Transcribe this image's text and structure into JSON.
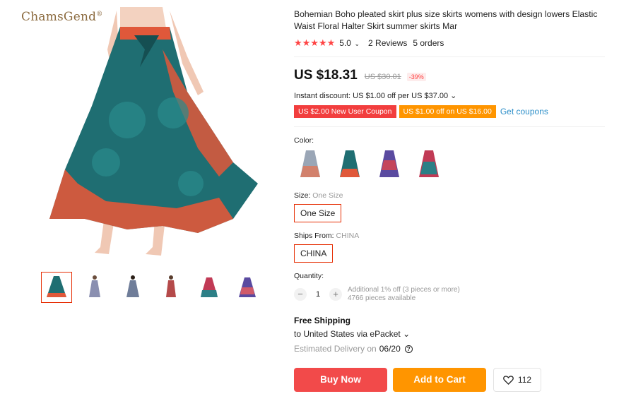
{
  "brand": {
    "name": "ChamsGend",
    "mark": "®"
  },
  "product": {
    "title": "Bohemian Boho pleated skirt plus size skirts womens with design lowers Elastic Waist Floral Halter Skirt summer skirts Mar",
    "rating": "5.0",
    "reviews": "2 Reviews",
    "orders": "5 orders"
  },
  "price": {
    "current": "US $18.31",
    "original": "US $30.01",
    "discount": "-39%",
    "instant_discount": "Instant discount: US $1.00 off per US $37.00"
  },
  "coupons": {
    "new_user": "US $2.00 New User Coupon",
    "store": "US $1.00 off on US $16.00",
    "get_label": "Get coupons"
  },
  "color": {
    "label": "Color:"
  },
  "size": {
    "label": "Size:",
    "value_hint": "One Size",
    "selected": "One Size"
  },
  "ships_from": {
    "label": "Ships From:",
    "value_hint": "CHINA",
    "selected": "CHINA"
  },
  "quantity": {
    "label": "Quantity:",
    "value": "1",
    "minus": "−",
    "plus": "+",
    "note": "Additional 1% off (3 pieces or more)",
    "available": "4766 pieces available"
  },
  "shipping": {
    "title": "Free Shipping",
    "to": "to United States via ePacket",
    "delivery_label": "Estimated Delivery on",
    "delivery_date": "06/20"
  },
  "actions": {
    "buy": "Buy Now",
    "cart": "Add to Cart",
    "wishlist_count": "112"
  },
  "colors": {
    "skirt_teal": "#1f6e72",
    "skirt_orange": "#e0583a",
    "accent_red": "#f24a4a",
    "accent_orange": "#ff9500",
    "link_blue": "#2d8fc9"
  },
  "icons": [
    "star-icon",
    "chevron-down-icon",
    "help-icon",
    "heart-icon",
    "minus-icon",
    "plus-icon"
  ]
}
